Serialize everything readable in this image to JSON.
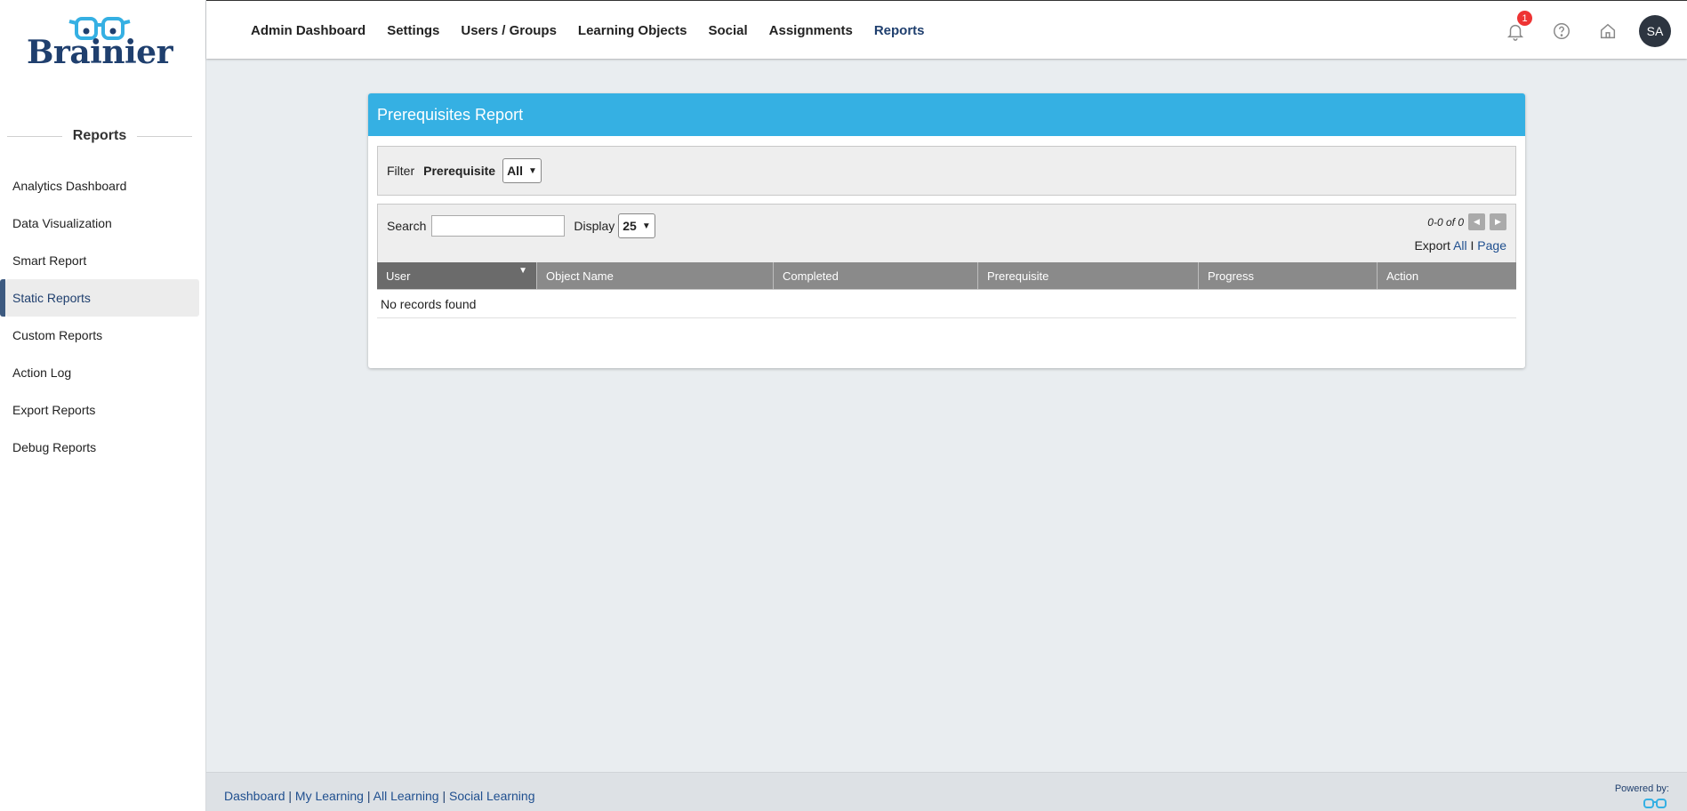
{
  "brand": {
    "name": "Brainier",
    "color": "#1f3f6e",
    "accent": "#35b0e3"
  },
  "sidebar": {
    "title": "Reports",
    "items": [
      {
        "label": "Analytics Dashboard"
      },
      {
        "label": "Data Visualization"
      },
      {
        "label": "Smart Report"
      },
      {
        "label": "Static Reports",
        "active": true
      },
      {
        "label": "Custom Reports"
      },
      {
        "label": "Action Log"
      },
      {
        "label": "Export Reports"
      },
      {
        "label": "Debug Reports"
      }
    ]
  },
  "topnav": {
    "items": [
      {
        "label": "Admin Dashboard"
      },
      {
        "label": "Settings"
      },
      {
        "label": "Users / Groups"
      },
      {
        "label": "Learning Objects"
      },
      {
        "label": "Social"
      },
      {
        "label": "Assignments"
      },
      {
        "label": "Reports",
        "active": true
      }
    ],
    "notification_count": "1",
    "avatar_initials": "SA",
    "icons": [
      "bell-icon",
      "help-icon",
      "home-icon"
    ]
  },
  "report": {
    "title": "Prerequisites Report",
    "filter": {
      "label": "Filter",
      "field_label": "Prerequisite",
      "selected": "All"
    },
    "grid": {
      "search_label": "Search",
      "search_value": "",
      "display_label": "Display",
      "display_value": "25",
      "range_text": "0-0 of 0",
      "export_label": "Export",
      "export_all": "All",
      "export_sep": "I",
      "export_page": "Page",
      "columns": [
        {
          "label": "User"
        },
        {
          "label": "Object Name"
        },
        {
          "label": "Completed"
        },
        {
          "label": "Prerequisite"
        },
        {
          "label": "Progress"
        },
        {
          "label": "Action"
        }
      ],
      "empty_text": "No records found"
    }
  },
  "footer": {
    "links": [
      "Dashboard",
      "My Learning",
      "All Learning",
      "Social Learning"
    ],
    "powered_by": "Powered by:"
  }
}
